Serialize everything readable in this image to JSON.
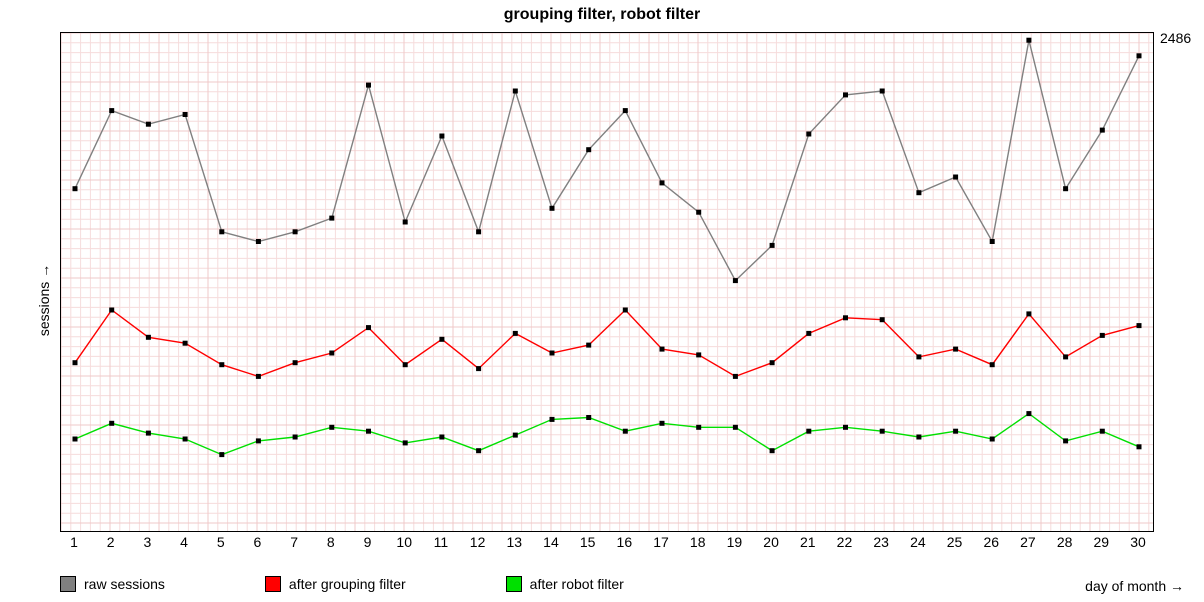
{
  "chart_data": {
    "type": "line",
    "title": "grouping filter, robot filter",
    "xlabel": "day of month →",
    "ylabel": "sessions →",
    "ylim": [
      0,
      2486
    ],
    "annotation_ymax": "2486",
    "categories": [
      1,
      2,
      3,
      4,
      5,
      6,
      7,
      8,
      9,
      10,
      11,
      12,
      13,
      14,
      15,
      16,
      17,
      18,
      19,
      20,
      21,
      22,
      23,
      24,
      25,
      26,
      27,
      28,
      29,
      30
    ],
    "series": [
      {
        "name": "raw sessions",
        "color": "#808080",
        "values": [
          1720,
          2120,
          2050,
          2100,
          1500,
          1450,
          1500,
          1570,
          2250,
          1550,
          1990,
          1500,
          2220,
          1620,
          1920,
          2120,
          1750,
          1600,
          1250,
          1430,
          2000,
          2200,
          2220,
          1700,
          1780,
          1450,
          2480,
          1720,
          2020,
          2400
        ]
      },
      {
        "name": "after grouping filter",
        "color": "#ff0000",
        "values": [
          830,
          1100,
          960,
          930,
          820,
          760,
          830,
          880,
          1010,
          820,
          950,
          800,
          980,
          880,
          920,
          1100,
          900,
          870,
          760,
          830,
          980,
          1060,
          1050,
          860,
          900,
          820,
          1080,
          860,
          970,
          1020
        ]
      },
      {
        "name": "after robot filter",
        "color": "#00e000",
        "values": [
          440,
          520,
          470,
          440,
          360,
          430,
          450,
          500,
          480,
          420,
          450,
          380,
          460,
          540,
          550,
          480,
          520,
          500,
          500,
          380,
          480,
          500,
          480,
          450,
          480,
          440,
          570,
          430,
          480,
          400
        ]
      }
    ],
    "legend": {
      "items": [
        {
          "label": "raw sessions",
          "color": "#808080"
        },
        {
          "label": "after grouping filter",
          "color": "#ff0000"
        },
        {
          "label": "after robot filter",
          "color": "#00e000"
        }
      ]
    }
  }
}
